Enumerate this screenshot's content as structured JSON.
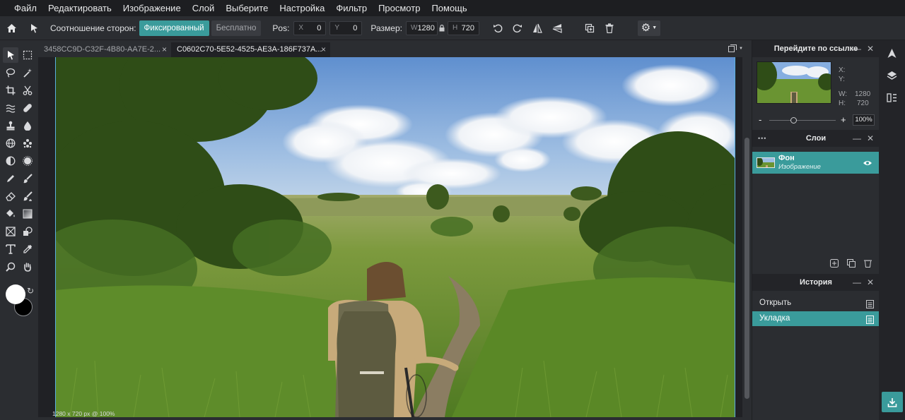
{
  "menu": [
    "Файл",
    "Редактировать",
    "Изображение",
    "Слой",
    "Выберите",
    "Настройка",
    "Фильтр",
    "Просмотр",
    "Помощь"
  ],
  "toolbar": {
    "aspect_label": "Соотношение сторон:",
    "aspect_fixed": "Фиксированный",
    "aspect_free": "Бесплатно",
    "pos_label": "Pos:",
    "x_key": "X",
    "x_val": "0",
    "y_key": "Y",
    "y_val": "0",
    "size_label": "Размер:",
    "w_key": "W",
    "w_val": "1280",
    "h_key": "H",
    "h_val": "720"
  },
  "tabs": [
    {
      "label": "3458CC9D-C32F-4B80-AA7E-2...",
      "close": "×"
    },
    {
      "label": "C0602C70-5E52-4525-AE3A-186F737A...",
      "close": "×"
    }
  ],
  "status": "1280 x 720 px @ 100%",
  "navigator": {
    "title": "Перейдите по ссылке",
    "x_label": "X:",
    "y_label": "Y:",
    "w_label": "W:",
    "w_val": "1280",
    "h_label": "H:",
    "h_val": "720",
    "minus": "-",
    "plus": "+",
    "zoom": "100%",
    "zoom_fraction": 0.35
  },
  "layers": {
    "title": "Слои",
    "items": [
      {
        "name": "Фон",
        "type": "Изображение"
      }
    ]
  },
  "history": {
    "title": "История",
    "items": [
      {
        "label": "Открыть"
      },
      {
        "label": "Укладка"
      }
    ]
  },
  "colors": {
    "accent": "#3a9b9b",
    "foreground": "#ffffff",
    "background": "#000000"
  }
}
